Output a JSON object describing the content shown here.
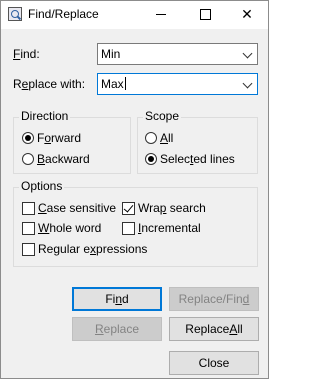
{
  "window": {
    "title": "Find/Replace",
    "controls": {
      "minimize": "minimize",
      "maximize": "maximize",
      "close": "close"
    }
  },
  "find": {
    "label_pre": "",
    "label_mnemonic": "F",
    "label_post": "ind:",
    "value": "Min"
  },
  "replace": {
    "label_pre": "R",
    "label_mnemonic": "e",
    "label_post": "place with:",
    "value": "Max"
  },
  "direction": {
    "title": "Direction",
    "forward": {
      "pre": "F",
      "mnemonic": "o",
      "post": "rward",
      "selected": true
    },
    "backward": {
      "pre": "",
      "mnemonic": "B",
      "post": "ackward",
      "selected": false
    }
  },
  "scope": {
    "title": "Scope",
    "all": {
      "pre": "",
      "mnemonic": "A",
      "post": "ll",
      "selected": false
    },
    "selected_lines": {
      "pre": "Selec",
      "mnemonic": "t",
      "post": "ed lines",
      "selected": true
    }
  },
  "options": {
    "title": "Options",
    "case_sensitive": {
      "pre": "",
      "mnemonic": "C",
      "post": "ase sensitive",
      "checked": false
    },
    "wrap_search": {
      "pre": "Wra",
      "mnemonic": "p",
      "post": " search",
      "checked": true
    },
    "whole_word": {
      "pre": "",
      "mnemonic": "W",
      "post": "hole word",
      "checked": false
    },
    "incremental": {
      "pre": "",
      "mnemonic": "I",
      "post": "ncremental",
      "checked": false
    },
    "regex": {
      "pre": "Regular e",
      "mnemonic": "x",
      "post": "pressions",
      "checked": false
    }
  },
  "buttons": {
    "find": {
      "pre": "Fi",
      "mnemonic": "n",
      "post": "d"
    },
    "replace_find": {
      "pre": "Replace/Fin",
      "mnemonic": "d",
      "post": ""
    },
    "replace": {
      "pre": "",
      "mnemonic": "R",
      "post": "eplace"
    },
    "replace_all": {
      "pre": "Replace ",
      "mnemonic": "A",
      "post": "ll"
    },
    "close": "Close"
  },
  "colors": {
    "window_bg": "#f0f0f0",
    "focus_accent": "#0078d7",
    "disabled_text": "#838383"
  }
}
